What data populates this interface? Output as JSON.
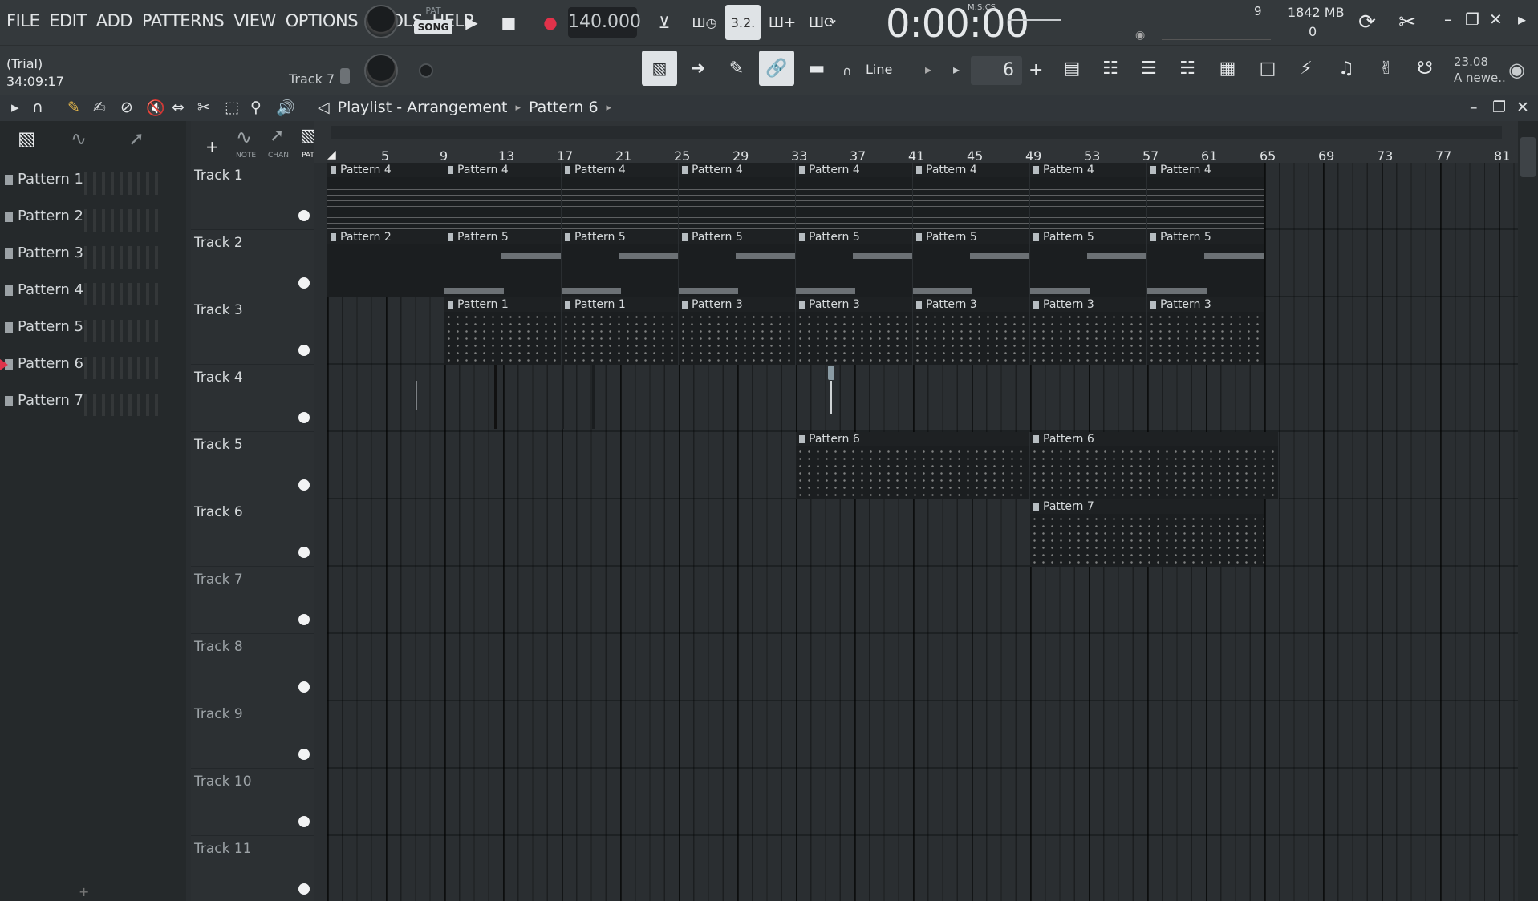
{
  "menu": [
    "FILE",
    "EDIT",
    "ADD",
    "PATTERNS",
    "VIEW",
    "OPTIONS",
    "TOOLS",
    "HELP"
  ],
  "transport": {
    "pat_label": "PAT",
    "song_label": "SONG",
    "tempo": "140.000",
    "time": "0:00:00",
    "time_unit": "M:S:CS",
    "numerator": "3.2."
  },
  "monitor": {
    "cpu": "9",
    "memory": "1842 MB",
    "polyphony": "0"
  },
  "hint": {
    "line1": "(Trial)",
    "line2": "34:09:17",
    "current_track": "Track 7"
  },
  "toolbar2": {
    "snap": "Line",
    "step": "6"
  },
  "news": {
    "version": "23.08",
    "text": "A newe.."
  },
  "playlist": {
    "breadcrumb": [
      "Playlist - Arrangement",
      "Pattern 6"
    ],
    "pattern_list": [
      "Pattern 1",
      "Pattern 2",
      "Pattern 3",
      "Pattern 4",
      "Pattern 5",
      "Pattern 6",
      "Pattern 7"
    ],
    "selected_pattern": "Pattern 6",
    "picker_labels": {
      "note": "NOTE",
      "chan": "CHAN",
      "pat": "PAT"
    },
    "ruler": [
      "5",
      "9",
      "13",
      "17",
      "21",
      "25",
      "29",
      "33",
      "37",
      "41",
      "45",
      "49",
      "53",
      "57",
      "61",
      "65",
      "69",
      "73",
      "77",
      "81"
    ],
    "tracks": [
      "Track 1",
      "Track 2",
      "Track 3",
      "Track 4",
      "Track 5",
      "Track 6",
      "Track 7",
      "Track 8",
      "Track 9",
      "Track 10",
      "Track 11"
    ],
    "clips": [
      {
        "track": 0,
        "bar": 1,
        "len": 8,
        "name": "Pattern 4",
        "kind": "p4"
      },
      {
        "track": 0,
        "bar": 9,
        "len": 8,
        "name": "Pattern 4",
        "kind": "p4"
      },
      {
        "track": 0,
        "bar": 17,
        "len": 8,
        "name": "Pattern 4",
        "kind": "p4"
      },
      {
        "track": 0,
        "bar": 25,
        "len": 8,
        "name": "Pattern 4",
        "kind": "p4"
      },
      {
        "track": 0,
        "bar": 33,
        "len": 8,
        "name": "Pattern 4",
        "kind": "p4"
      },
      {
        "track": 0,
        "bar": 41,
        "len": 8,
        "name": "Pattern 4",
        "kind": "p4"
      },
      {
        "track": 0,
        "bar": 49,
        "len": 8,
        "name": "Pattern 4",
        "kind": "p4"
      },
      {
        "track": 0,
        "bar": 57,
        "len": 8,
        "name": "Pattern 4",
        "kind": "p4"
      },
      {
        "track": 1,
        "bar": 1,
        "len": 8,
        "name": "Pattern 2",
        "kind": "p2"
      },
      {
        "track": 1,
        "bar": 9,
        "len": 8,
        "name": "Pattern 5",
        "kind": "p5"
      },
      {
        "track": 1,
        "bar": 17,
        "len": 8,
        "name": "Pattern 5",
        "kind": "p5"
      },
      {
        "track": 1,
        "bar": 25,
        "len": 8,
        "name": "Pattern 5",
        "kind": "p5"
      },
      {
        "track": 1,
        "bar": 33,
        "len": 8,
        "name": "Pattern 5",
        "kind": "p5"
      },
      {
        "track": 1,
        "bar": 41,
        "len": 8,
        "name": "Pattern 5",
        "kind": "p5"
      },
      {
        "track": 1,
        "bar": 49,
        "len": 8,
        "name": "Pattern 5",
        "kind": "p5"
      },
      {
        "track": 1,
        "bar": 57,
        "len": 8,
        "name": "Pattern 5",
        "kind": "p5"
      },
      {
        "track": 2,
        "bar": 9,
        "len": 8,
        "name": "Pattern 1",
        "kind": "notes"
      },
      {
        "track": 2,
        "bar": 17,
        "len": 8,
        "name": "Pattern 1",
        "kind": "notes"
      },
      {
        "track": 2,
        "bar": 25,
        "len": 8,
        "name": "Pattern 3",
        "kind": "notes"
      },
      {
        "track": 2,
        "bar": 33,
        "len": 8,
        "name": "Pattern 3",
        "kind": "notes"
      },
      {
        "track": 2,
        "bar": 41,
        "len": 8,
        "name": "Pattern 3",
        "kind": "notes"
      },
      {
        "track": 2,
        "bar": 49,
        "len": 8,
        "name": "Pattern 3",
        "kind": "notes"
      },
      {
        "track": 2,
        "bar": 57,
        "len": 8,
        "name": "Pattern 3",
        "kind": "notes"
      },
      {
        "track": 4,
        "bar": 33,
        "len": 16,
        "name": "Pattern 6",
        "kind": "notes"
      },
      {
        "track": 4,
        "bar": 49,
        "len": 17,
        "name": "Pattern 6",
        "kind": "notes"
      },
      {
        "track": 5,
        "bar": 49,
        "len": 16,
        "name": "Pattern 7",
        "kind": "notes"
      }
    ]
  }
}
